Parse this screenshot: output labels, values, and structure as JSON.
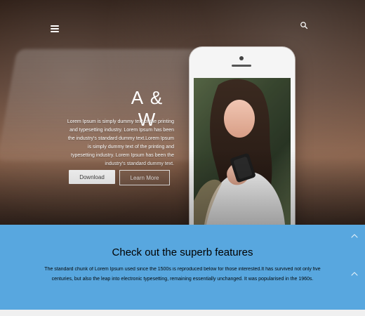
{
  "hero": {
    "brand": "A & W",
    "text": "Lorem Ipsum is simply dummy text of the printing and typesetting industry. Lorem Ipsum has been the industry's standard dummy text.Lorem Ipsum is simply dummy text of the printing and typesetting industry. Lorem Ipsum has been the industry's standard dummy text.",
    "download_label": "Download",
    "learn_more_label": "Learn More"
  },
  "icons": {
    "menu": "menu-icon",
    "search": "search-icon",
    "chevron_up": "chevron-up-icon"
  },
  "features": {
    "title": "Check out the superb features",
    "desc": "The standard chunk of Lorem Ipsum used since the 1500s is reproduced below for those interested.It has survived not only five centuries, but also the leap into electronic typesetting, remaining essentially unchanged. It was popularised in the 1960s."
  },
  "colors": {
    "accent_blue": "#58a7df",
    "button_bg": "#ffffff"
  }
}
